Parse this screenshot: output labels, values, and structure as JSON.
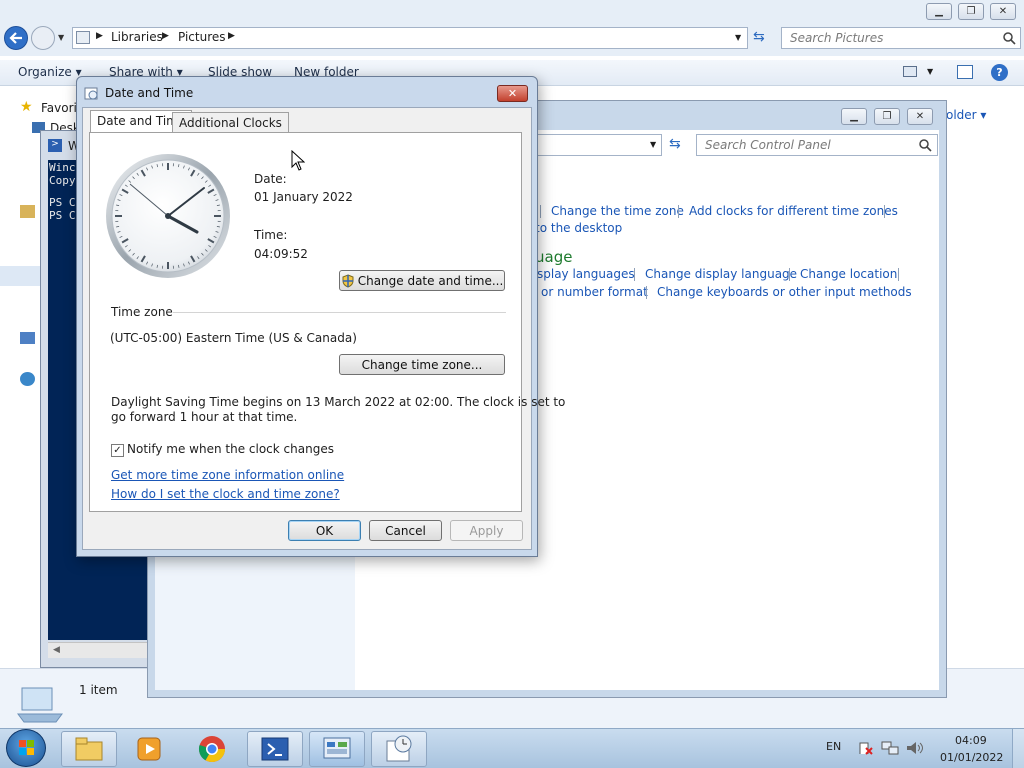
{
  "explorer": {
    "breadcrumb": [
      "Libraries",
      "Pictures"
    ],
    "search_placeholder": "Search Pictures",
    "toolbar": {
      "organize": "Organize",
      "share_with": "Share with",
      "slide_show": "Slide show",
      "new_folder": "New folder"
    },
    "nav_favorites": "Favorit",
    "nav_desktop": "Desk",
    "right_folder_text": "older",
    "status_count": "1 item"
  },
  "powershell": {
    "title": "W",
    "lines": [
      "Winc",
      "Copy",
      "",
      "PS C",
      "PS C"
    ]
  },
  "control_panel": {
    "search_placeholder": "Search Control Panel",
    "links_row1": [
      "Change the time zone",
      "Add clocks for different time zones"
    ],
    "links_row1b": "to the desktop",
    "heading": "uage",
    "links_row2": [
      "splay languages",
      "Change display language",
      "Change location"
    ],
    "links_row3": [
      "or number format",
      "Change keyboards or other input methods"
    ]
  },
  "dialog": {
    "title": "Date and Time",
    "tabs": [
      "Date and Time",
      "Additional Clocks"
    ],
    "date_label": "Date:",
    "date_value": "01 January 2022",
    "time_label": "Time:",
    "time_value": "04:09:52",
    "change_datetime_button": "Change date and time...",
    "timezone_label": "Time zone",
    "timezone_value": "(UTC-05:00) Eastern Time (US & Canada)",
    "change_timezone_button": "Change time zone...",
    "dst_line1": "Daylight Saving Time begins on 13 March 2022 at 02:00. The clock is set to",
    "dst_line2": "go forward 1 hour at that time.",
    "notify_checkbox_label": "Notify me when the clock changes",
    "notify_checked": true,
    "link_more_info": "Get more time zone information online",
    "link_how_to": "How do I set the clock and time zone?",
    "ok_button": "OK",
    "cancel_button": "Cancel",
    "apply_button": "Apply"
  },
  "taskbar": {
    "language": "EN",
    "clock_time": "04:09",
    "clock_date": "01/01/2022",
    "items": [
      "start-orb",
      "explorer",
      "media-player",
      "chrome",
      "powershell",
      "control-panel",
      "date-time"
    ]
  },
  "colors": {
    "accent": "#1a56b6",
    "taskbar": "#b9cfe6",
    "powershell_bg": "#012456"
  }
}
